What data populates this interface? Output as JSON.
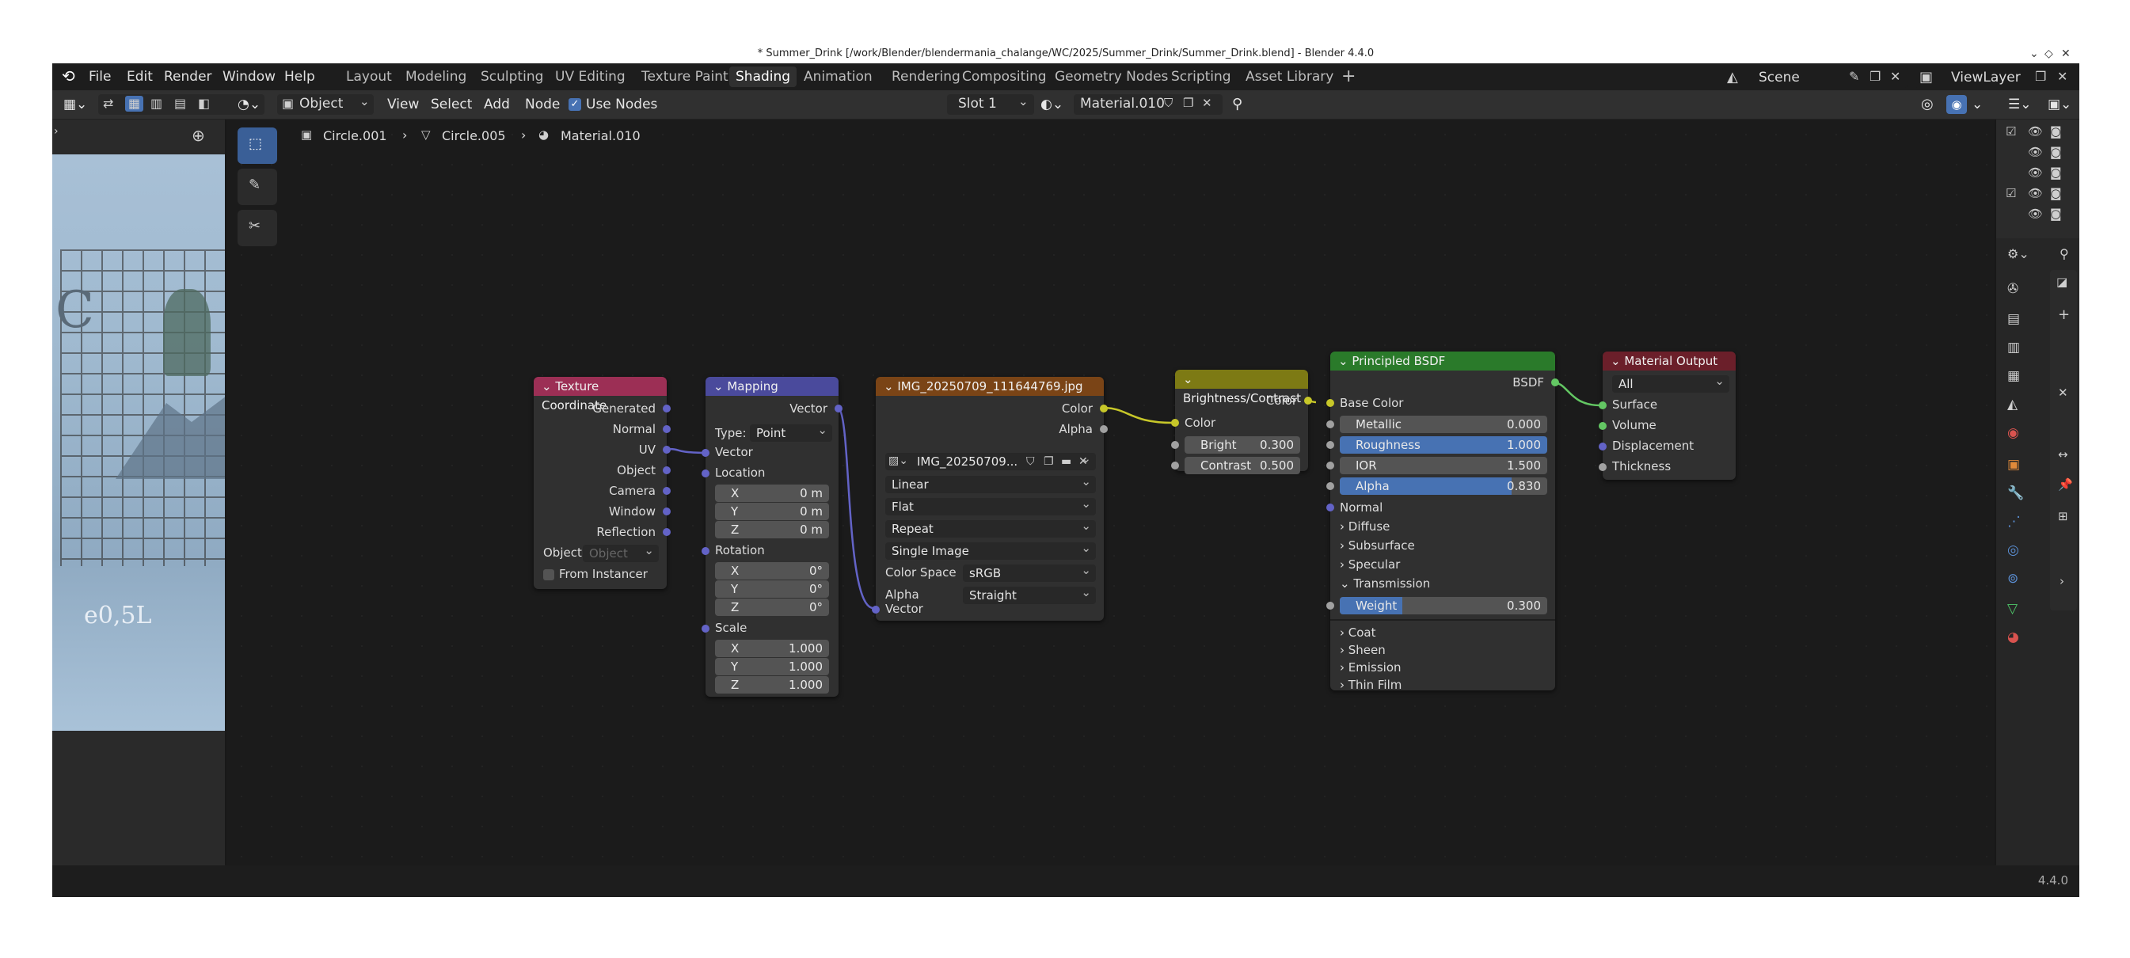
{
  "window": {
    "title": "* Summer_Drink [/work/Blender/blendermania_chalange/WC/2025/Summer_Drink/Summer_Drink.blend] - Blender 4.4.0"
  },
  "menu": [
    "File",
    "Edit",
    "Render",
    "Window",
    "Help"
  ],
  "workspaces": [
    "Layout",
    "Modeling",
    "Sculpting",
    "UV Editing",
    "Texture Paint",
    "Shading",
    "Animation",
    "Rendering",
    "Compositing",
    "Geometry Nodes",
    "Scripting",
    "Asset Library"
  ],
  "active_workspace": "Shading",
  "scene": "Scene",
  "view_layer": "ViewLayer",
  "header": {
    "mode": "Object",
    "view": "View",
    "select": "Select",
    "add": "Add",
    "node": "Node",
    "use_nodes": "Use Nodes",
    "slot": "Slot 1",
    "material": "Material.010"
  },
  "breadcrumb": [
    "Circle.001",
    "Circle.005",
    "Material.010"
  ],
  "nodes": {
    "texcoord": {
      "title": "Texture Coordinate",
      "outputs": [
        "Generated",
        "Normal",
        "UV",
        "Object",
        "Camera",
        "Window",
        "Reflection"
      ],
      "object_label": "Object:",
      "object_placeholder": "Object",
      "from_instancer": "From Instancer"
    },
    "mapping": {
      "title": "Mapping",
      "output": "Vector",
      "type_label": "Type:",
      "type_value": "Point",
      "vector": "Vector",
      "location": "Location",
      "loc": [
        [
          "X",
          "0 m"
        ],
        [
          "Y",
          "0 m"
        ],
        [
          "Z",
          "0 m"
        ]
      ],
      "rotation": "Rotation",
      "rot": [
        [
          "X",
          "0°"
        ],
        [
          "Y",
          "0°"
        ],
        [
          "Z",
          "0°"
        ]
      ],
      "scale": "Scale",
      "scl": [
        [
          "X",
          "1.000"
        ],
        [
          "Y",
          "1.000"
        ],
        [
          "Z",
          "1.000"
        ]
      ]
    },
    "image": {
      "title": "IMG_20250709_111644769.jpg",
      "color": "Color",
      "alpha": "Alpha",
      "image_name": "IMG_20250709...",
      "interpolation": "Linear",
      "projection": "Flat",
      "extension": "Repeat",
      "source": "Single Image",
      "color_space_label": "Color Space",
      "color_space": "sRGB",
      "alpha_label": "Alpha",
      "alpha_mode": "Straight",
      "vector": "Vector"
    },
    "brightness": {
      "title": "Brightness/Contrast",
      "output": "Color",
      "input": "Color",
      "bright_label": "Bright",
      "bright": "0.300",
      "contrast_label": "Contrast",
      "contrast": "0.500"
    },
    "bsdf": {
      "title": "Principled BSDF",
      "output": "BSDF",
      "base_color": "Base Color",
      "metallic_label": "Metallic",
      "metallic": "0.000",
      "roughness_label": "Roughness",
      "roughness": "1.000",
      "ior_label": "IOR",
      "ior": "1.500",
      "alpha_label": "Alpha",
      "alpha": "0.830",
      "alpha_fill": 0.83,
      "normal": "Normal",
      "diffuse": "Diffuse",
      "subsurface": "Subsurface",
      "specular": "Specular",
      "transmission": "Transmission",
      "weight_label": "Weight",
      "weight": "0.300",
      "weight_fill": 0.3,
      "coat": "Coat",
      "sheen": "Sheen",
      "emission": "Emission",
      "thin_film": "Thin Film"
    },
    "output": {
      "title": "Material Output",
      "target": "All",
      "surface": "Surface",
      "volume": "Volume",
      "displacement": "Displacement",
      "thickness": "Thickness"
    }
  },
  "photo_text": "e0,5L",
  "version": "4.4.0",
  "colors": {
    "texcoord_header": "#9c2f55",
    "mapping_header": "#4a4a9c",
    "image_header": "#7a4416",
    "brightness_header": "#7d7a14",
    "bsdf_header": "#2a7a2a",
    "output_header": "#6b1f2a",
    "socket_vector": "#6363c7",
    "socket_color": "#c7c729",
    "socket_float": "#a1a1a1",
    "socket_shader": "#63c763",
    "accent": "#4772b3"
  }
}
